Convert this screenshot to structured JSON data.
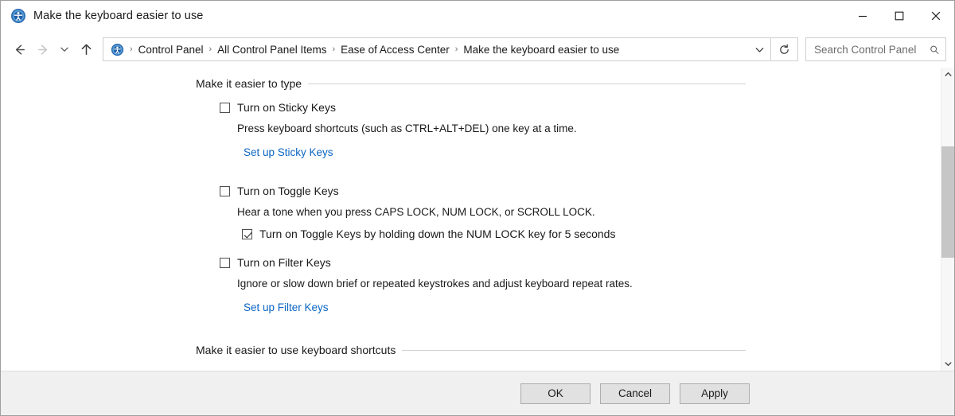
{
  "window": {
    "title": "Make the keyboard easier to use",
    "icon": "ease-of-access-icon",
    "controls": {
      "minimize": "Minimize",
      "maximize": "Maximize",
      "close": "Close"
    }
  },
  "navbar": {
    "back": "Back",
    "forward": "Forward",
    "recent_locations": "Recent locations",
    "up": "Up to Ease of Access Center",
    "address_icon": "ease-of-access-icon",
    "breadcrumbs": [
      "Control Panel",
      "All Control Panel Items",
      "Ease of Access Center",
      "Make the keyboard easier to use"
    ],
    "separator": "›",
    "dropdown": "Previous locations",
    "refresh": "Refresh",
    "search": {
      "placeholder": "Search Control Panel",
      "value": ""
    }
  },
  "content": {
    "sections": [
      {
        "heading": "Make it easier to type",
        "options": [
          {
            "label": "Turn on Sticky Keys",
            "checked": false,
            "description": "Press keyboard shortcuts (such as CTRL+ALT+DEL) one key at a time.",
            "link": "Set up Sticky Keys",
            "sub_option": null
          },
          {
            "label": "Turn on Toggle Keys",
            "checked": false,
            "description": "Hear a tone when you press CAPS LOCK, NUM LOCK, or SCROLL LOCK.",
            "link": null,
            "sub_option": {
              "label": "Turn on Toggle Keys by holding down the NUM LOCK key for 5 seconds",
              "checked": true
            }
          },
          {
            "label": "Turn on Filter Keys",
            "checked": false,
            "description": "Ignore or slow down brief or repeated keystrokes and adjust keyboard repeat rates.",
            "link": "Set up Filter Keys",
            "sub_option": null
          }
        ]
      },
      {
        "heading": "Make it easier to use keyboard shortcuts",
        "options": []
      }
    ]
  },
  "scrollbar": {
    "up_arrow": "Scroll up",
    "down_arrow": "Scroll down",
    "thumb": "Vertical scroll thumb"
  },
  "footer": {
    "ok": "OK",
    "cancel": "Cancel",
    "apply": "Apply"
  },
  "colors": {
    "link": "#0b65c2",
    "window_bg": "#ffffff",
    "footer_bg": "#f0f0f0",
    "scroll_thumb": "#c6c6c6",
    "button_face": "#e1e1e1"
  }
}
